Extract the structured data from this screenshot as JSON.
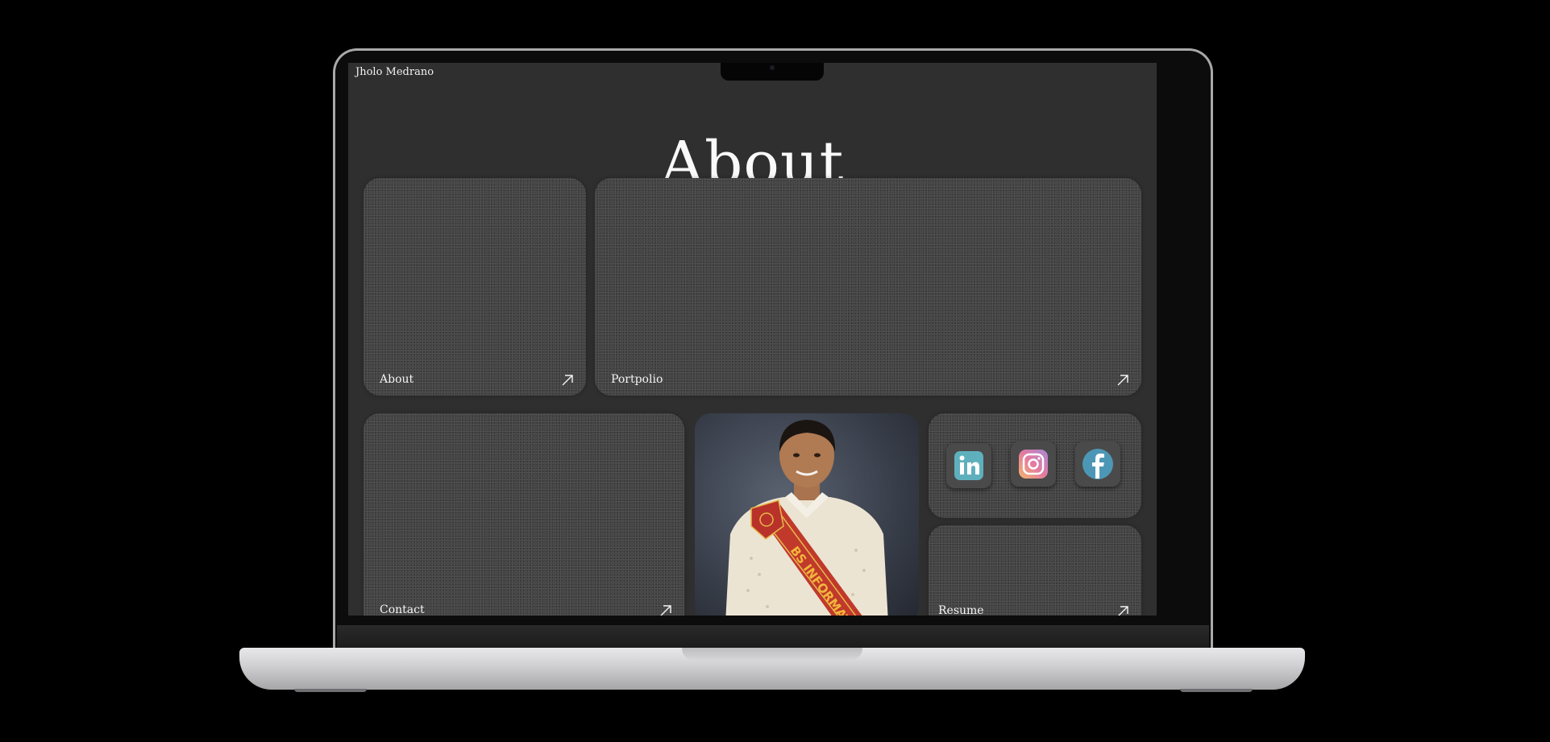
{
  "site": {
    "name": "Jholo Medrano"
  },
  "hero": {
    "title": "About"
  },
  "cards": {
    "about": {
      "label": "About",
      "icon": "arrow-up-right-icon"
    },
    "portfolio": {
      "label": "Portpolio",
      "icon": "arrow-up-right-icon"
    },
    "contact": {
      "label": "Contact",
      "icon": "arrow-up-right-icon"
    },
    "resume": {
      "label": "Resume",
      "icon": "arrow-up-right-icon"
    }
  },
  "photo": {
    "sash_text": "BS INFORMATION"
  },
  "socials": [
    {
      "name": "linkedin",
      "icon": "linkedin-icon",
      "glyph": "in"
    },
    {
      "name": "instagram",
      "icon": "instagram-icon"
    },
    {
      "name": "facebook",
      "icon": "facebook-icon",
      "glyph": "f"
    }
  ],
  "colors": {
    "page_background": "#000000",
    "screen_background": "#2f2f2f",
    "card_background": "#444444",
    "text": "#f4f4f4",
    "linkedin": "#5fb0bd",
    "facebook": "#4d97b6",
    "sash": "#c0392b"
  }
}
